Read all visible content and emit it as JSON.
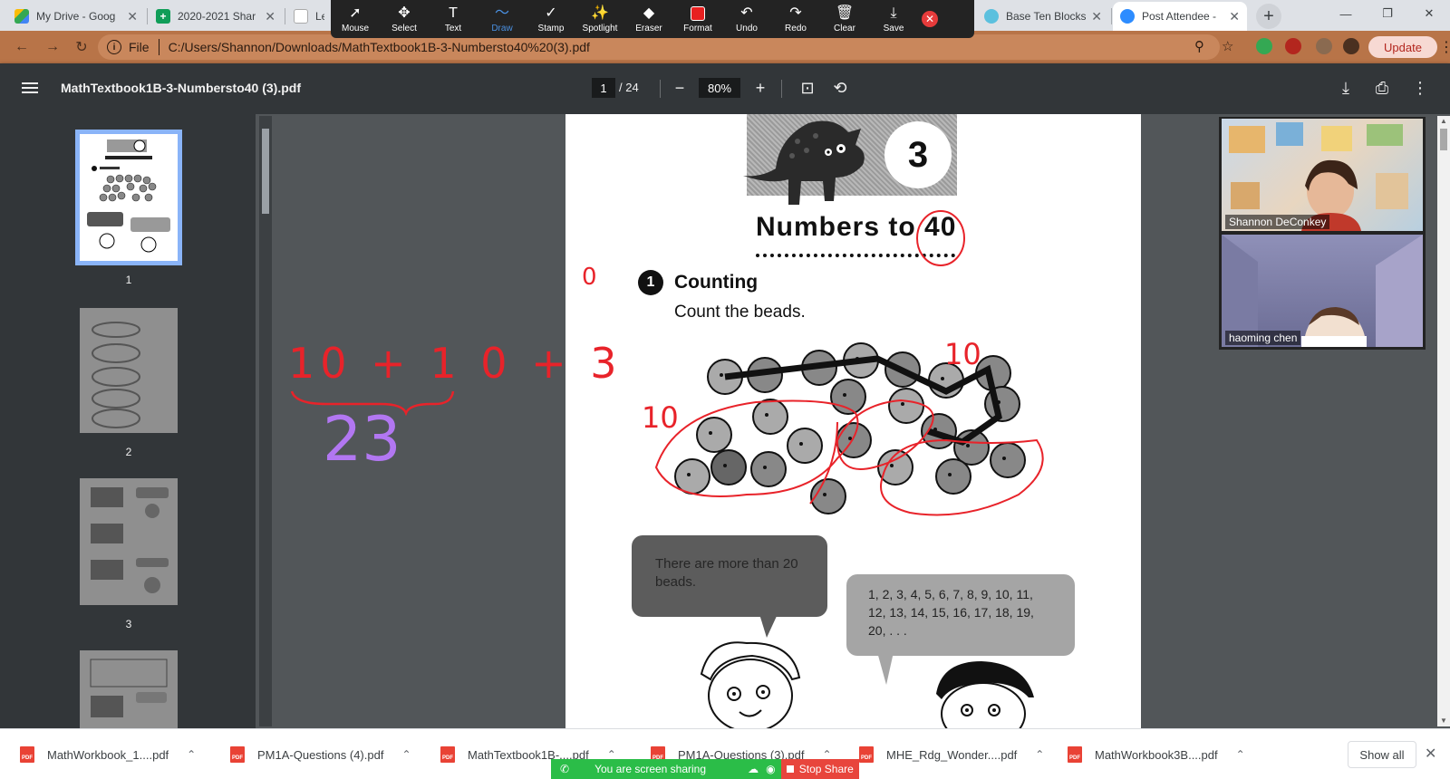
{
  "browser": {
    "tabs": [
      {
        "title": "My Drive - Goog",
        "favicon_color": "#1a73e8"
      },
      {
        "title": "2020-2021 Shar",
        "favicon_color": "#0f9d58"
      },
      {
        "title": "Les",
        "favicon_color": "#ffffff"
      },
      {
        "title": "Base Ten Blocks",
        "favicon_color": "#5bc0de"
      },
      {
        "title": "Post Attendee -",
        "favicon_color": "#2d8cff"
      }
    ],
    "address": {
      "file_label": "File",
      "url": "C:/Users/Shannon/Downloads/MathTextbook1B-3-Numbersto40%20(3).pdf"
    },
    "update_label": "Update"
  },
  "annotation_toolbar": {
    "tools": [
      {
        "label": "Mouse",
        "glyph": "➚"
      },
      {
        "label": "Select",
        "glyph": "✥"
      },
      {
        "label": "Text",
        "glyph": "T"
      },
      {
        "label": "Draw",
        "glyph": "〜"
      },
      {
        "label": "Stamp",
        "glyph": "✓"
      },
      {
        "label": "Spotlight",
        "glyph": "✨"
      },
      {
        "label": "Eraser",
        "glyph": "◆"
      },
      {
        "label": "Format",
        "glyph": ""
      },
      {
        "label": "Undo",
        "glyph": "↶"
      },
      {
        "label": "Redo",
        "glyph": "↷"
      },
      {
        "label": "Clear",
        "glyph": "🗑"
      },
      {
        "label": "Save",
        "glyph": "⤓"
      }
    ],
    "active_tool": "Draw",
    "format_color": "#e82020"
  },
  "pdf_viewer": {
    "title": "MathTextbook1B-3-Numbersto40 (3).pdf",
    "current_page": "1",
    "total_pages": "/ 24",
    "zoom": "80%",
    "thumbnails": [
      {
        "num": "1"
      },
      {
        "num": "2"
      },
      {
        "num": "3"
      }
    ]
  },
  "page_content": {
    "chapter_number": "3",
    "chapter_title": "Numbers to 40",
    "section_number": "1",
    "section_title": "Counting",
    "section_instruction": "Count the beads.",
    "bubble_left": "There are more than 20 beads.",
    "bubble_right": "1, 2, 3, 4, 5, 6, 7, 8, 9, 10, 11, 12, 13, 14, 15, 16, 17, 18, 19, 20, . . ."
  },
  "annotations": {
    "zero_mark": "0",
    "label_top_ten": "10",
    "label_left_ten": "10",
    "expression": "10 + 1 0 + 3",
    "sum": "23",
    "ink_red": "#e8232a",
    "ink_purple": "#b277f2"
  },
  "video_panel": {
    "participants": [
      {
        "name": "Shannon DeConkey"
      },
      {
        "name": "haoming chen"
      }
    ]
  },
  "downloads": {
    "items": [
      {
        "name": "MathWorkbook_1....pdf"
      },
      {
        "name": "PM1A-Questions (4).pdf"
      },
      {
        "name": "MathTextbook1B-....pdf"
      },
      {
        "name": "PM1A-Questions (3).pdf"
      },
      {
        "name": "MHE_Rdg_Wonder....pdf"
      },
      {
        "name": "MathWorkbook3B....pdf"
      }
    ],
    "show_all_label": "Show all"
  },
  "screen_share": {
    "status": "You are screen sharing",
    "stop_label": "Stop Share"
  }
}
